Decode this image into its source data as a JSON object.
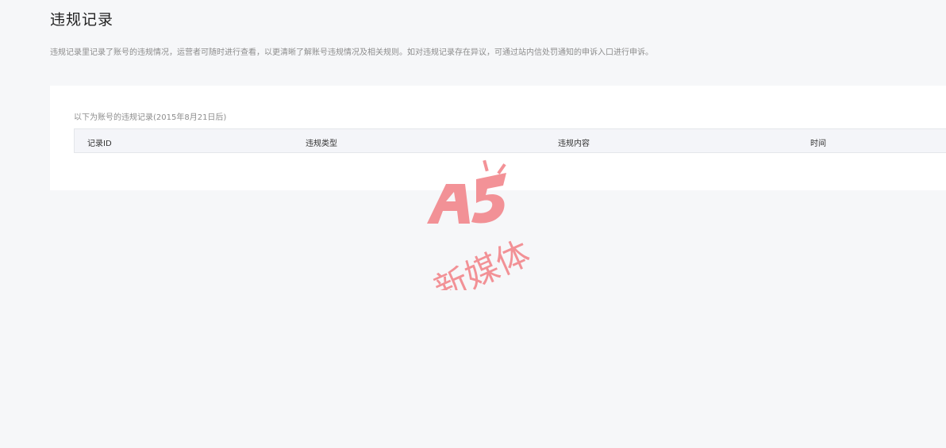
{
  "header": {
    "title": "违规记录",
    "description": "违规记录里记录了账号的违规情况，运营者可随时进行查看，以更清晰了解账号违规情况及相关规则。如对违规记录存在异议，可通过站内信处罚通知的申诉入口进行申诉。"
  },
  "records": {
    "caption": "以下为账号的违规记录(2015年8月21日后)",
    "columns": [
      "记录ID",
      "违规类型",
      "违规内容",
      "时间"
    ],
    "rows": []
  },
  "watermark": {
    "logo_text": "A5",
    "text": "新媒体",
    "color": "#f2878c"
  }
}
